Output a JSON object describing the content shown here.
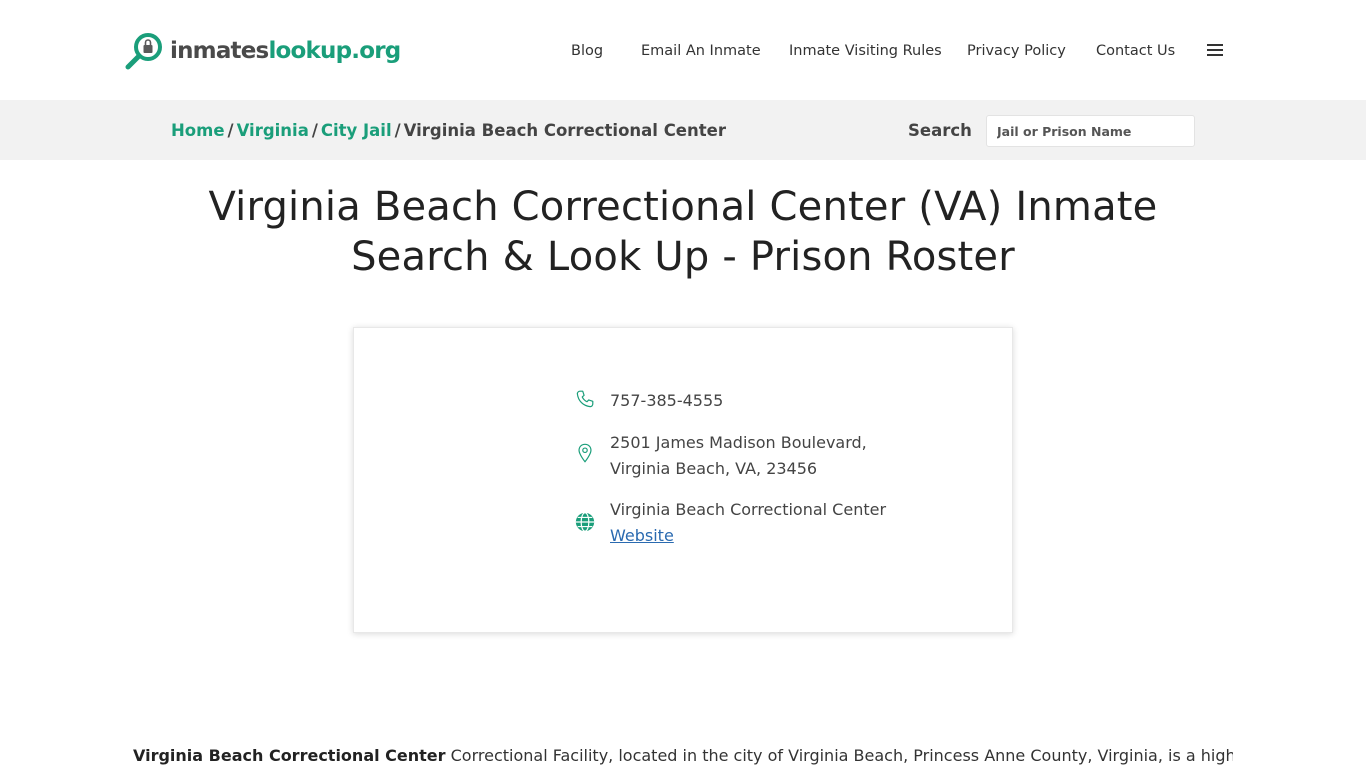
{
  "logo": {
    "part1": "inmates",
    "part2": "lookup.org",
    "accent": "#1a9e7a"
  },
  "nav": {
    "items": [
      {
        "label": "Blog"
      },
      {
        "label": "Email An Inmate"
      },
      {
        "label": "Inmate Visiting Rules"
      },
      {
        "label": "Privacy Policy"
      },
      {
        "label": "Contact Us"
      }
    ],
    "menu_icon": "hamburger-icon"
  },
  "breadcrumb": {
    "items": [
      "Home",
      "Virginia",
      "City Jail"
    ],
    "current": "Virginia Beach Correctional Center",
    "separator": "/"
  },
  "search": {
    "label": "Search",
    "placeholder": "Jail or Prison Name"
  },
  "page": {
    "title": "Virginia Beach Correctional Center (VA) Inmate Search & Look Up - Prison Roster"
  },
  "contact": {
    "phone": "757-385-4555",
    "address": "2501 James Madison Boulevard, Virginia Beach, VA, 23456",
    "website_name": "Virginia Beach Correctional Center",
    "website_link": "Website",
    "icons": [
      "phone-icon",
      "map-pin-icon",
      "globe-icon"
    ]
  },
  "description": {
    "bold": "Virginia Beach Correctional Center",
    "text": " Correctional Facility, located in the city of Virginia Beach, Princess Anne County, Virginia, is a highly secured"
  }
}
